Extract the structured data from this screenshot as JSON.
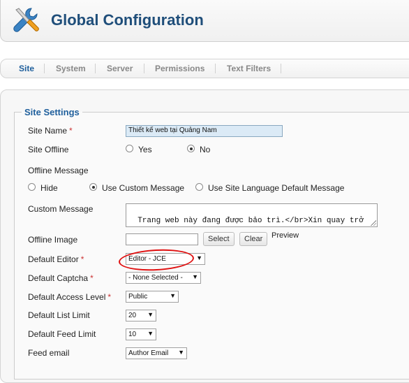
{
  "header": {
    "title": "Global Configuration",
    "icon": "tools-icon"
  },
  "tabs": [
    {
      "label": "Site",
      "active": true
    },
    {
      "label": "System",
      "active": false
    },
    {
      "label": "Server",
      "active": false
    },
    {
      "label": "Permissions",
      "active": false
    },
    {
      "label": "Text Filters",
      "active": false
    }
  ],
  "site_settings": {
    "legend": "Site Settings",
    "site_name": {
      "label": "Site Name",
      "required": "*",
      "value": "Thiết kế web tại Quảng Nam"
    },
    "site_offline": {
      "label": "Site Offline",
      "options": [
        "Yes",
        "No"
      ],
      "selected": "No"
    },
    "offline_message": {
      "label": "Offline Message",
      "options": [
        "Hide",
        "Use Custom Message",
        "Use Site Language Default Message"
      ],
      "selected": "Use Custom Message"
    },
    "custom_message": {
      "label": "Custom Message",
      "value": "Trang web này đang được bảo trì.</br>Xin quay trở lại sau."
    },
    "offline_image": {
      "label": "Offline Image",
      "value": "",
      "select_button": "Select",
      "clear_button": "Clear",
      "preview_label": "Preview"
    },
    "default_editor": {
      "label": "Default Editor",
      "required": "*",
      "value": "Editor - JCE"
    },
    "default_captcha": {
      "label": "Default Captcha",
      "required": "*",
      "value": "- None Selected -"
    },
    "default_access_level": {
      "label": "Default Access Level",
      "required": "*",
      "value": "Public"
    },
    "default_list_limit": {
      "label": "Default List Limit",
      "value": "20"
    },
    "default_feed_limit": {
      "label": "Default Feed Limit",
      "value": "10"
    },
    "feed_email": {
      "label": "Feed email",
      "value": "Author Email"
    }
  },
  "colors": {
    "title": "#1f4e7a",
    "tab_active": "#1f5f9c",
    "annotation": "#e01010"
  }
}
